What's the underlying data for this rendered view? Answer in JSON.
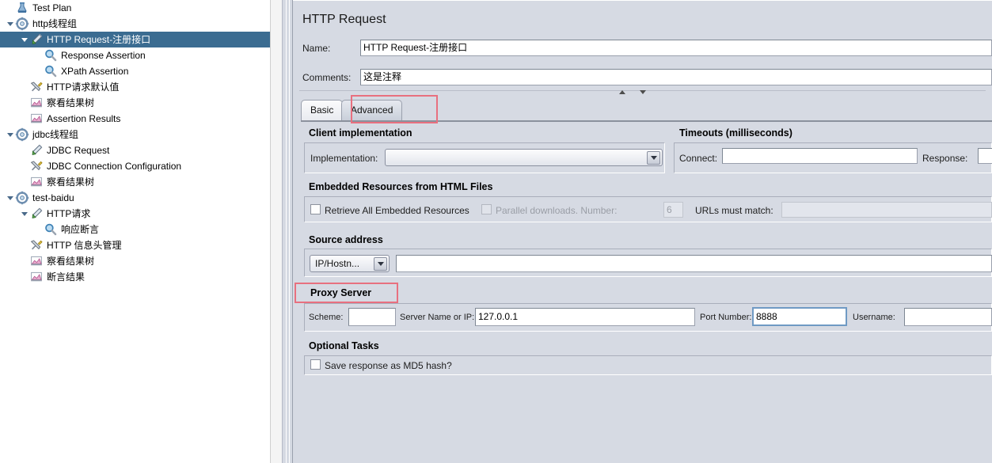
{
  "tree": {
    "items": [
      {
        "label": "Test Plan",
        "depth": 0,
        "icon": "testplan-icon",
        "toggle": "none",
        "selected": false
      },
      {
        "label": "http线程组",
        "depth": 0,
        "icon": "threadgroup-icon",
        "toggle": "expanded",
        "selected": false
      },
      {
        "label": "HTTP Request-注册接口",
        "depth": 1,
        "icon": "sampler-icon",
        "toggle": "expanded",
        "selected": true
      },
      {
        "label": "Response Assertion",
        "depth": 2,
        "icon": "assertion-icon",
        "toggle": "none",
        "selected": false
      },
      {
        "label": "XPath Assertion",
        "depth": 2,
        "icon": "assertion-icon",
        "toggle": "none",
        "selected": false
      },
      {
        "label": "HTTP请求默认值",
        "depth": 1,
        "icon": "config-icon",
        "toggle": "none",
        "selected": false
      },
      {
        "label": "察看结果树",
        "depth": 1,
        "icon": "listener-icon",
        "toggle": "none",
        "selected": false
      },
      {
        "label": "Assertion Results",
        "depth": 1,
        "icon": "listener-icon",
        "toggle": "none",
        "selected": false
      },
      {
        "label": "jdbc线程组",
        "depth": 0,
        "icon": "threadgroup-icon",
        "toggle": "expanded",
        "selected": false
      },
      {
        "label": "JDBC Request",
        "depth": 1,
        "icon": "sampler-icon",
        "toggle": "none",
        "selected": false
      },
      {
        "label": "JDBC Connection Configuration",
        "depth": 1,
        "icon": "config-icon",
        "toggle": "none",
        "selected": false
      },
      {
        "label": "察看结果树",
        "depth": 1,
        "icon": "listener-icon",
        "toggle": "none",
        "selected": false
      },
      {
        "label": "test-baidu",
        "depth": 0,
        "icon": "threadgroup-icon",
        "toggle": "expanded",
        "selected": false
      },
      {
        "label": "HTTP请求",
        "depth": 1,
        "icon": "sampler-icon",
        "toggle": "expanded",
        "selected": false
      },
      {
        "label": "响应断言",
        "depth": 2,
        "icon": "assertion-icon",
        "toggle": "none",
        "selected": false
      },
      {
        "label": "HTTP 信息头管理",
        "depth": 1,
        "icon": "config-icon",
        "toggle": "none",
        "selected": false
      },
      {
        "label": "察看结果树",
        "depth": 1,
        "icon": "listener-icon",
        "toggle": "none",
        "selected": false
      },
      {
        "label": "断言结果",
        "depth": 1,
        "icon": "listener-icon",
        "toggle": "none",
        "selected": false
      }
    ]
  },
  "panel": {
    "title": "HTTP Request",
    "name_label": "Name:",
    "name_value": "HTTP Request-注册接口",
    "comments_label": "Comments:",
    "comments_value": "这是注释"
  },
  "tabs": [
    {
      "label": "Basic",
      "active": false
    },
    {
      "label": "Advanced",
      "active": true
    }
  ],
  "client_implementation": {
    "title": "Client implementation",
    "implementation_label": "Implementation:",
    "implementation_value": ""
  },
  "timeouts": {
    "title": "Timeouts (milliseconds)",
    "connect_label": "Connect:",
    "connect_value": "",
    "response_label": "Response:",
    "response_value": ""
  },
  "embedded": {
    "title": "Embedded Resources from HTML Files",
    "retrieve_label": "Retrieve All Embedded Resources",
    "retrieve_checked": false,
    "parallel_label": "Parallel downloads. Number:",
    "parallel_checked": false,
    "parallel_number": "6",
    "urls_label": "URLs must match:",
    "urls_value": ""
  },
  "source_address": {
    "title": "Source address",
    "type_value": "IP/Hostn...",
    "address_value": ""
  },
  "proxy": {
    "title": "Proxy Server",
    "scheme_label": "Scheme:",
    "scheme_value": "",
    "server_label": "Server Name or IP:",
    "server_value": "127.0.0.1",
    "port_label": "Port Number:",
    "port_value": "8888",
    "username_label": "Username:",
    "username_value": ""
  },
  "optional": {
    "title": "Optional Tasks",
    "md5_label": "Save response as MD5 hash?",
    "md5_checked": false
  },
  "colors": {
    "selection": "#3b6c91",
    "panel_bg": "#d6dae3",
    "highlight_box": "#e8707f",
    "focus_border": "#6f9ac4"
  }
}
